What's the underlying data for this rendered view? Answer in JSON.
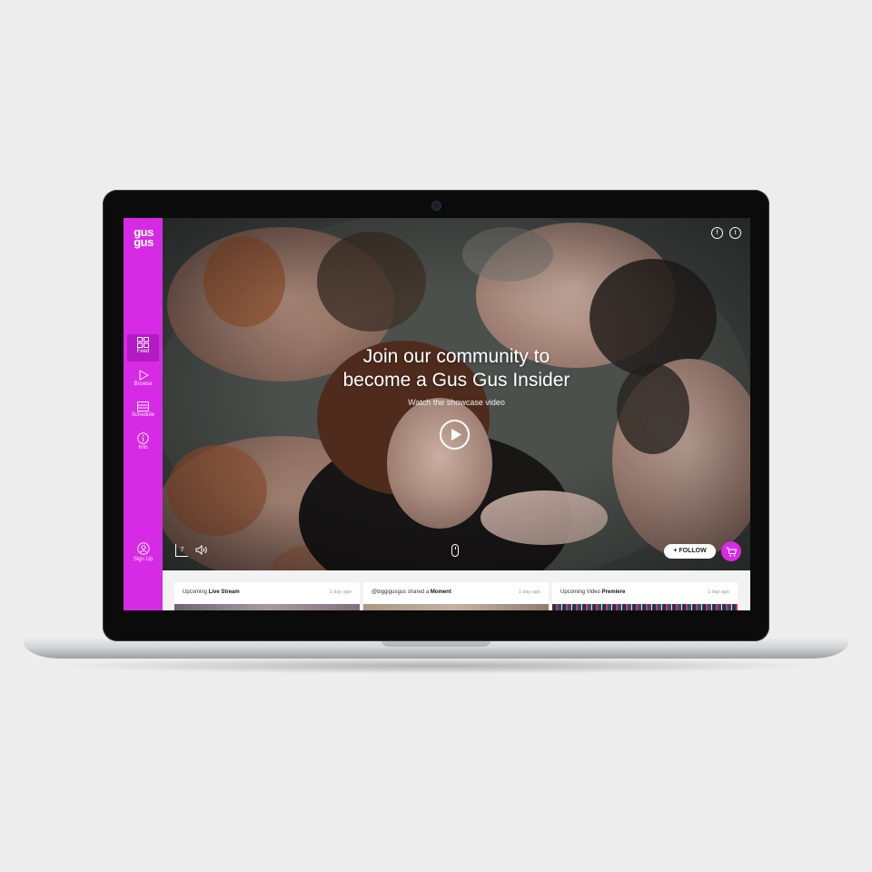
{
  "app": {
    "logo": [
      "gus",
      "gus"
    ],
    "brand_color": "#d62be4"
  },
  "sidebar": {
    "items": [
      {
        "label": "Feed",
        "icon": "grid-icon",
        "active": true
      },
      {
        "label": "Browse",
        "icon": "play-outline-icon",
        "active": false
      },
      {
        "label": "Schedule",
        "icon": "list-icon",
        "active": false
      },
      {
        "label": "Info",
        "icon": "info-icon",
        "active": false
      }
    ],
    "signup_label": "Sign Up",
    "signup_icon": "user-circle-icon"
  },
  "hero": {
    "title_line1": "Join our community to",
    "title_line2": "become a Gus Gus Insider",
    "subtitle": "Watch the showcase video",
    "social": [
      {
        "icon": "facebook-icon",
        "glyph": "f"
      },
      {
        "icon": "twitter-icon",
        "glyph": "t"
      }
    ],
    "episode_number": "7",
    "follow_label": "FOLLOW",
    "follow_icon": "plus-icon"
  },
  "feed": {
    "cards": [
      {
        "prefix": "Upcoming ",
        "emphasis": "Live Stream",
        "time": "1 day ago"
      },
      {
        "prefix": "@biggigusgus shared a ",
        "emphasis": "Moment",
        "time": "1 day ago"
      },
      {
        "prefix": "Upcoming Video ",
        "emphasis": "Premiere",
        "time": "1 day ago"
      }
    ]
  }
}
